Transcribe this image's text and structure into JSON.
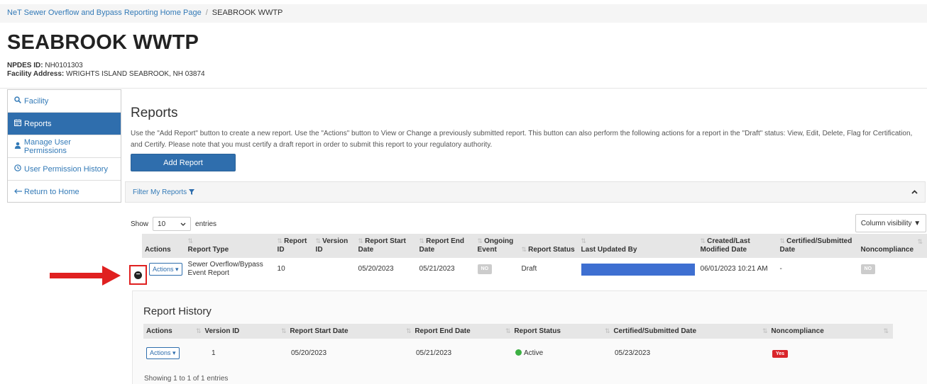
{
  "breadcrumb": {
    "home": "NeT Sewer Overflow and Bypass Reporting Home Page",
    "separator": "/",
    "current": "SEABROOK WWTP"
  },
  "facility": {
    "name": "SEABROOK WWTP",
    "npdes_label": "NPDES ID:",
    "npdes_id": "NH0101303",
    "address_label": "Facility Address:",
    "address": "WRIGHTS ISLAND SEABROOK, NH 03874"
  },
  "sidebar": {
    "items": [
      {
        "label": "Facility",
        "icon": "search-icon",
        "active": false
      },
      {
        "label": "Reports",
        "icon": "calendar-icon",
        "active": true
      },
      {
        "label": "Manage User Permissions",
        "icon": "user-icon",
        "active": false
      },
      {
        "label": "User Permission History",
        "icon": "clock-icon",
        "active": false
      },
      {
        "label": "Return to Home",
        "icon": "arrow-left-icon",
        "active": false
      }
    ]
  },
  "reports": {
    "title": "Reports",
    "instructions": "Use the \"Add Report\" button to create a new report. Use the \"Actions\" button to View or Change a previously submitted report. This button can also perform the following actions for a report in the \"Draft\" status: View, Edit, Delete, Flag for Certification, and Certify. Please note that you must certify a draft report in order to submit this report to your regulatory authority.",
    "add_button": "Add Report",
    "filter_label": "Filter My Reports",
    "show_label": "Show",
    "entries_value": "10",
    "entries_label": "entries",
    "column_visibility": "Column visibility"
  },
  "main_table": {
    "headers": {
      "actions": "Actions",
      "report_type": "Report Type",
      "report_id": "Report ID",
      "version_id": "Version ID",
      "start_date": "Report Start Date",
      "end_date": "Report End Date",
      "ongoing": "Ongoing Event",
      "status": "Report Status",
      "updated_by": "Last Updated By",
      "created": "Created/Last Modified Date",
      "certified": "Certified/Submitted Date",
      "noncompliance": "Noncompliance"
    },
    "row": {
      "actions": "Actions",
      "report_type": "Sewer Overflow/Bypass Event Report",
      "report_id": "10",
      "version_id": "",
      "start_date": "05/20/2023",
      "end_date": "05/21/2023",
      "ongoing": "NO",
      "status": "Draft",
      "created": "06/01/2023 10:21 AM",
      "certified": "-",
      "noncompliance": "NO"
    }
  },
  "history": {
    "title": "Report History",
    "headers": {
      "actions": "Actions",
      "version_id": "Version ID",
      "start_date": "Report Start Date",
      "end_date": "Report End Date",
      "status": "Report Status",
      "certified": "Certified/Submitted Date",
      "noncompliance": "Noncompliance"
    },
    "row": {
      "actions": "Actions",
      "version_id": "1",
      "start_date": "05/20/2023",
      "end_date": "05/21/2023",
      "status": "Active",
      "certified": "05/23/2023",
      "noncompliance": "Yes"
    },
    "showing": "Showing 1 to 1 of 1 entries"
  },
  "colors": {
    "primary": "#2f6ead",
    "link": "#337ab7",
    "annotation_red": "#e02020",
    "redaction_blue": "#3e6fd1",
    "active_green": "#3cb043",
    "noncompliance_red": "#d9252b"
  }
}
